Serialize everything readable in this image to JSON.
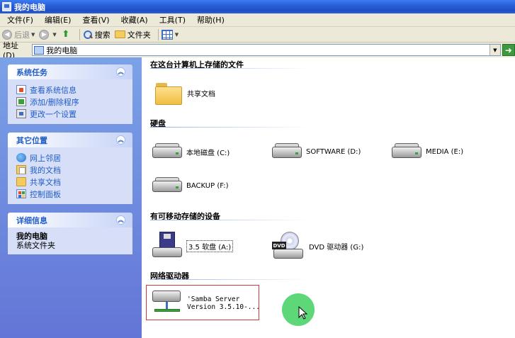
{
  "window": {
    "title": "我的电脑"
  },
  "menu": [
    "文件(F)",
    "编辑(E)",
    "查看(V)",
    "收藏(A)",
    "工具(T)",
    "帮助(H)"
  ],
  "toolbar": {
    "back": "后退",
    "search": "搜索",
    "folders": "文件夹"
  },
  "address": {
    "label": "地址(D)",
    "value": "我的电脑"
  },
  "left": {
    "system_tasks": {
      "title": "系统任务",
      "items": [
        "查看系统信息",
        "添加/删除程序",
        "更改一个设置"
      ]
    },
    "other_places": {
      "title": "其它位置",
      "items": [
        "网上邻居",
        "我的文档",
        "共享文档",
        "控制面板"
      ]
    },
    "details": {
      "title": "详细信息",
      "name": "我的电脑",
      "desc": "系统文件夹"
    }
  },
  "main": {
    "sections": {
      "stored": "在这台计算机上存储的文件",
      "hdd": "硬盘",
      "removable": "有可移动存储的设备",
      "network": "网络驱动器"
    },
    "shared_docs": "共享文档",
    "drives": [
      "本地磁盘 (C:)",
      "SOFTWARE (D:)",
      "MEDIA (E:)",
      "BACKUP (F:)"
    ],
    "removable_items": [
      "3.5 软盘 (A:)",
      "DVD 驱动器 (G:)"
    ],
    "network_item": {
      "line1": "'Samba Server",
      "line2": "Version 3.5.10-..."
    },
    "dvd_badge": "DVD"
  }
}
